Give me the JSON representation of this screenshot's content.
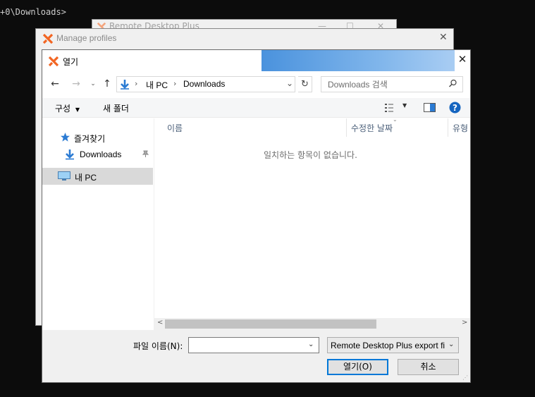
{
  "console": {
    "line": "+0\\Downloads>"
  },
  "rdp_window": {
    "title": "Remote Desktop Plus"
  },
  "manage_profiles": {
    "title": "Manage profiles"
  },
  "dialog": {
    "title": "열기",
    "address": {
      "segments": [
        "내 PC",
        "Downloads"
      ]
    },
    "search": {
      "placeholder": "Downloads 검색"
    },
    "toolbar": {
      "organize": "구성",
      "new_folder": "새 폴더"
    },
    "nav": {
      "favorites": "즐겨찾기",
      "downloads": "Downloads",
      "this_pc": "내 PC"
    },
    "columns": {
      "name": "이름",
      "date_modified": "수정한 날짜",
      "type": "유형"
    },
    "empty_message": "일치하는 항목이 없습니다.",
    "filename_label": "파일 이름(N):",
    "filename_value": "",
    "filter": "Remote Desktop Plus export fi",
    "open_button": "열기(O)",
    "cancel_button": "취소"
  },
  "colors": {
    "accent": "#0078d7",
    "brand": "#f26522",
    "titleband": "#4a92dd"
  }
}
